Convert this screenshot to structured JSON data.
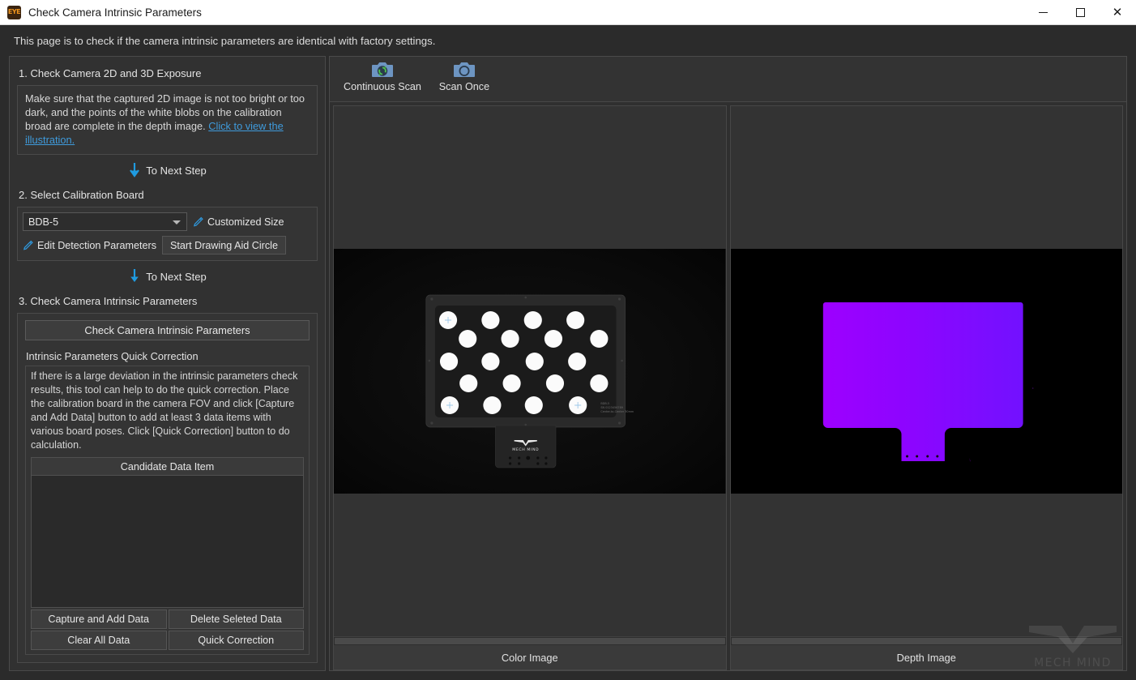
{
  "window": {
    "title": "Check Camera Intrinsic Parameters",
    "icon": "eye-app-icon",
    "icon_text": "EYE",
    "minimize_label": "—",
    "maximize_label": "□",
    "close_label": "✕"
  },
  "hint": {
    "text": "This page is to check if the camera intrinsic parameters are identical with factory settings."
  },
  "left_panel": {
    "step1": {
      "title": "1. Check Camera 2D and 3D Exposure",
      "description": "Make sure that the captured 2D image is not too bright or too dark, and the points of the white blobs on the calibration broad are complete in the depth image. ",
      "link_text": "Click to view the illustration."
    },
    "next_step_1": {
      "label": "To Next Step",
      "icon": "arrow-down-icon"
    },
    "step2": {
      "title": "2. Select Calibration Board",
      "board_selected": "BDB-5",
      "board_options": [
        "BDB-5"
      ],
      "customized_size_label": "Customized Size",
      "edit_detection_label": "Edit Detection Parameters",
      "start_drawing_label": "Start Drawing Aid Circle"
    },
    "next_step_2": {
      "label": "To Next Step",
      "icon": "arrow-down-icon"
    },
    "step3": {
      "title": "3. Check Camera Intrinsic Parameters",
      "check_button": "Check Camera Intrinsic Parameters",
      "quick_correction_title": "Intrinsic Parameters Quick Correction",
      "quick_correction_desc": "If there is a large deviation in the intrinsic parameters check results, this tool can help to do the quick correction. Place the calibration board in the camera FOV and click [Capture and Add Data] button to add at least 3 data items with various board poses. Click [Quick Correction] button to do calculation.",
      "list_header": "Candidate Data Item",
      "list_items": [],
      "buttons": [
        "Capture and Add Data",
        "Delete Seleted Data",
        "Clear All Data",
        "Quick Correction"
      ]
    }
  },
  "right_panel": {
    "toolbar": [
      {
        "label": "Continuous Scan",
        "icon": "camera-continuous-scan-icon"
      },
      {
        "label": "Scan Once",
        "icon": "camera-scan-once-icon"
      }
    ],
    "views": [
      {
        "label": "Color Image",
        "name": "color-image-view"
      },
      {
        "label": "Depth Image",
        "name": "depth-image-view"
      }
    ],
    "watermark_text": "MECH MIND"
  },
  "colors": {
    "accent_blue": "#3f9bdc",
    "window_bg": "#2b2b2b",
    "panel_bg": "#343434",
    "depth_magenta": "#9d00ff",
    "depth_violet": "#7b0cff",
    "icon_camera_blue": "#6d95c2",
    "icon_refresh_green": "#4fc04f",
    "title_bar_bg": "#ffffff"
  }
}
